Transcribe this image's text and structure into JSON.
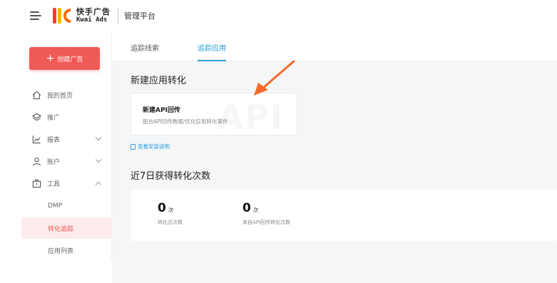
{
  "header": {
    "logo_cn": "快手广告",
    "logo_en": "Kwai Ads",
    "platform_title": "管理平台"
  },
  "sidebar": {
    "create_button": "创建广告",
    "items": [
      {
        "label": "我的首页",
        "icon": "home-icon"
      },
      {
        "label": "推广",
        "icon": "layers-icon"
      },
      {
        "label": "报表",
        "icon": "chart-icon",
        "expand": "down"
      },
      {
        "label": "账户",
        "icon": "user-icon",
        "expand": "down"
      },
      {
        "label": "工具",
        "icon": "toolbox-icon",
        "expand": "up"
      }
    ],
    "sub_items": [
      {
        "label": "DMP",
        "active": false
      },
      {
        "label": "转化追踪",
        "active": true
      },
      {
        "label": "应用列表",
        "active": false
      }
    ]
  },
  "tabs": [
    {
      "label": "追踪线索",
      "active": false
    },
    {
      "label": "追踪应用",
      "active": true
    }
  ],
  "section1": {
    "title": "新建应用转化",
    "card_title": "新建API回传",
    "card_desc": "配合API回传数据/优化应用转化事件",
    "card_watermark": "API",
    "doc_link": "查看安装说明"
  },
  "section2": {
    "title": "近7日获得转化次数",
    "stats": [
      {
        "value": "0",
        "unit": "次",
        "label": "转化总次数"
      },
      {
        "value": "0",
        "unit": "次",
        "label": "来自API回传转化次数"
      }
    ]
  },
  "colors": {
    "brand_red": "#f05a57",
    "accent_blue": "#2a9fd8",
    "arrow": "#f26b2b"
  }
}
